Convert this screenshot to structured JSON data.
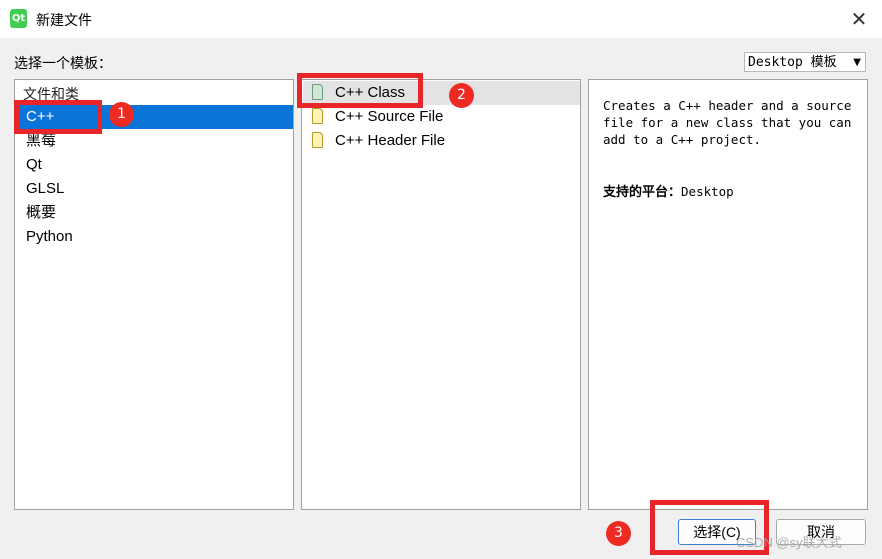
{
  "window": {
    "title": "新建文件",
    "app_icon_text": "Qt",
    "close_glyph": "✕"
  },
  "choose_label": "选择一个模板：",
  "template_filter": {
    "selected": "Desktop 模板",
    "arrow": "▼"
  },
  "categories": {
    "header": "文件和类",
    "items": [
      {
        "label": "C++",
        "selected": true
      },
      {
        "label": "黑莓",
        "selected": false
      },
      {
        "label": "Qt",
        "selected": false
      },
      {
        "label": "GLSL",
        "selected": false
      },
      {
        "label": "概要",
        "selected": false
      },
      {
        "label": "Python",
        "selected": false
      }
    ]
  },
  "templates": [
    {
      "label": "C++ Class",
      "selected": true
    },
    {
      "label": "C++ Source File",
      "selected": false
    },
    {
      "label": "C++ Header File",
      "selected": false
    }
  ],
  "description": {
    "text": "Creates a C++ header and a source file for a new class that you can add to a C++ project.",
    "platform_label": "支持的平台：",
    "platform_value": "Desktop"
  },
  "buttons": {
    "select": "选择(C)",
    "cancel": "取消"
  },
  "annotations": {
    "badge1": "1",
    "badge2": "2",
    "badge3": "3",
    "color": "#e8262a"
  },
  "watermark": "CSDN @sy联大式",
  "colors": {
    "selection": "#0a74d8",
    "template_selection": "#e3e3e3"
  }
}
